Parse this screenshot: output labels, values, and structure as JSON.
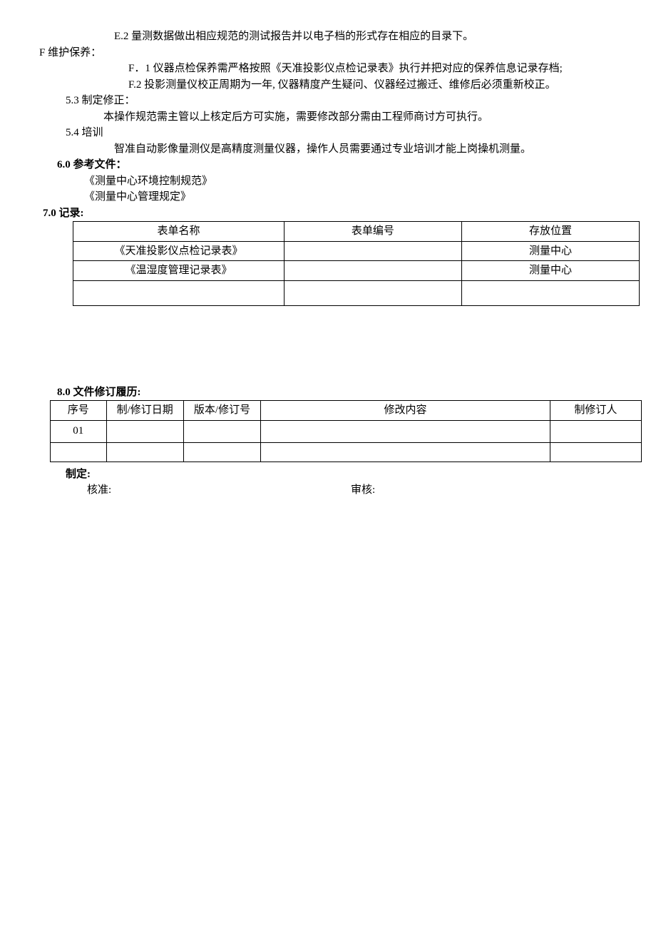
{
  "lines": {
    "e2": "E.2 量测数据做出相应规范的测试报告并以电子档的形式存在相应的目录下。",
    "f_head": "F 维护保养：",
    "f1": "F．1 仪器点检保养需严格按照《天准投影仪点检记录表》执行并把对应的保养信息记录存档;",
    "f2": "F.2 投影测量仪校正周期为一年, 仪器精度产生疑问、仪器经过搬迁、维修后必须重新校正。",
    "s53": "5.3 制定修正：",
    "s53_body": "本操作规范需主管以上核定后方可实施，需要修改部分需由工程师商讨方可执行。",
    "s54": "5.4 培训",
    "s54_body": "智准自动影像量测仪是高精度测量仪器，操作人员需要通过专业培训才能上岗操机测量。",
    "s60": "6.0 参考文件：",
    "ref1": "《测量中心环境控制规范》",
    "ref2": "《测量中心管理规定》",
    "s70": "7.0 记录:",
    "s80": "8.0 文件修订履历:",
    "make": "制定:",
    "approve": "核准:",
    "review": "审核:"
  },
  "records_table": {
    "headers": {
      "name": "表单名称",
      "code": "表单编号",
      "loc": "存放位置"
    },
    "rows": [
      {
        "name": "《天准投影仪点检记录表》",
        "code": "",
        "loc": "测量中心"
      },
      {
        "name": "《温湿度管理记录表》",
        "code": "",
        "loc": "测量中心"
      },
      {
        "name": "",
        "code": "",
        "loc": ""
      }
    ]
  },
  "revision_table": {
    "headers": {
      "seq": "序号",
      "date": "制/修订日期",
      "ver": "版本/修订号",
      "content": "修改内容",
      "author": "制修订人"
    },
    "rows": [
      {
        "seq": "01",
        "date": "",
        "ver": "",
        "content": "",
        "author": ""
      },
      {
        "seq": "",
        "date": "",
        "ver": "",
        "content": "",
        "author": ""
      }
    ]
  }
}
